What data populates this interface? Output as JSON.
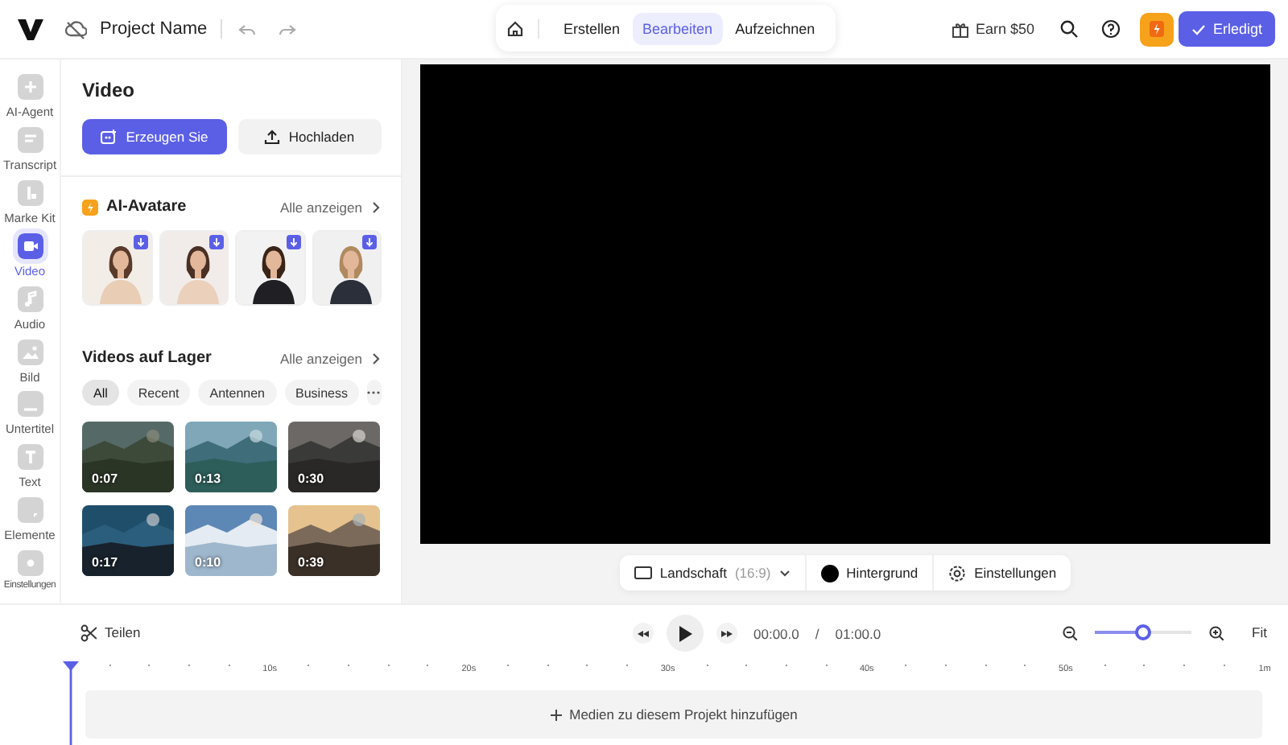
{
  "header": {
    "project_name": "Project Name",
    "modes": [
      {
        "label": "Erstellen",
        "selected": false
      },
      {
        "label": "Bearbeiten",
        "selected": true
      },
      {
        "label": "Aufzeichnen",
        "selected": false
      }
    ],
    "earn": "Earn $50",
    "done_button": "Erledigt"
  },
  "rail": {
    "items": [
      {
        "label": "AI-Agent",
        "selected": false
      },
      {
        "label": "Transcript",
        "selected": false
      },
      {
        "label": "Marke Kit",
        "selected": false
      },
      {
        "label": "Video",
        "selected": true
      },
      {
        "label": "Audio",
        "selected": false
      },
      {
        "label": "Bild",
        "selected": false
      },
      {
        "label": "Untertitel",
        "selected": false
      },
      {
        "label": "Text",
        "selected": false
      },
      {
        "label": "Elemente",
        "selected": false
      },
      {
        "label": "Einstellungen",
        "selected": false
      }
    ]
  },
  "panel": {
    "title": "Video",
    "buttons": [
      {
        "label": "Erzeugen Sie",
        "kind": "primary"
      },
      {
        "label": "Hochladen",
        "kind": "secondary"
      }
    ],
    "avatars": {
      "title": "AI-Avatare",
      "see_all": "Alle anzeigen"
    },
    "stock": {
      "title": "Videos auf Lager",
      "see_all": "Alle anzeigen",
      "filters": [
        {
          "label": "All",
          "selected": true
        },
        {
          "label": "Recent",
          "selected": false
        },
        {
          "label": "Antennen",
          "selected": false
        },
        {
          "label": "Business",
          "selected": false
        }
      ],
      "videos": [
        {
          "duration": "0:07"
        },
        {
          "duration": "0:13"
        },
        {
          "duration": "0:30"
        },
        {
          "duration": "0:17"
        },
        {
          "duration": "0:10"
        },
        {
          "duration": "0:39"
        }
      ]
    }
  },
  "preview": {
    "format": "Landschaft",
    "format_ratio": "(16:9)",
    "background": "Hintergrund",
    "settings": "Einstellungen"
  },
  "timeline": {
    "split": "Teilen",
    "current_time": "00:00.0",
    "separator": "/",
    "total_time": "01:00.0",
    "zoom": {
      "level": 0.5
    },
    "fit": "Fit",
    "ticks": [
      "10s",
      "20s",
      "30s",
      "40s",
      "50s",
      "1m"
    ],
    "add_media": "Medien zu diesem Projekt hinzufügen"
  }
}
